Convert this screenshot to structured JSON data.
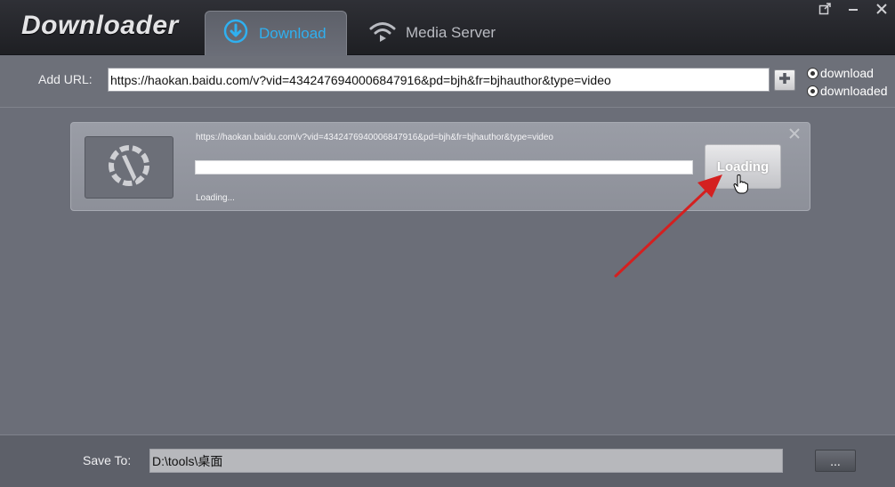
{
  "app": {
    "title": "Downloader"
  },
  "tabs": [
    {
      "label": "Download",
      "icon": "download-circle-icon",
      "active": true,
      "color": "#2fb0f0"
    },
    {
      "label": "Media Server",
      "icon": "wifi-icon",
      "active": false
    }
  ],
  "window_controls": [
    "popout-icon",
    "minimize-icon",
    "close-icon"
  ],
  "url_bar": {
    "label": "Add URL:",
    "value": "https://haokan.baidu.com/v?vid=4342476940006847916&pd=bjh&fr=bjhauthor&type=video"
  },
  "filter": {
    "options": [
      "download",
      "downloaded"
    ]
  },
  "task": {
    "url": "https://haokan.baidu.com/v?vid=4342476940006847916&pd=bjh&fr=bjhauthor&type=video",
    "progress": 0,
    "status": "Loading...",
    "button_label": "Loading"
  },
  "save": {
    "label": "Save To:",
    "path": "D:\\tools\\桌面",
    "browse_label": "..."
  },
  "colors": {
    "accent": "#2fb0f0",
    "background": "#6b6e78",
    "annotation_arrow": "#d42020"
  }
}
